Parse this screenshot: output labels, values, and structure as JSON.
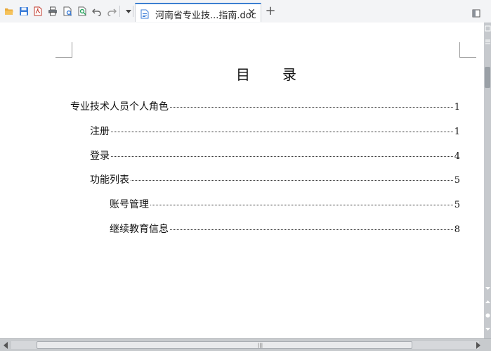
{
  "toolbar": {
    "icons": [
      "open-folder-icon",
      "save-icon",
      "export-pdf-icon",
      "print-icon",
      "print-preview-icon",
      "find-icon",
      "undo-icon",
      "redo-icon",
      "more-dropdown-icon"
    ],
    "tab": {
      "label": "河南省专业技...指南.doc",
      "close_glyph": "✕"
    },
    "new_tab_glyph": "+"
  },
  "document": {
    "title": "目　　录",
    "toc": [
      {
        "label": "专业技术人员个人角色",
        "page": "1",
        "level": 1
      },
      {
        "label": "注册",
        "page": "1",
        "level": 2
      },
      {
        "label": "登录",
        "page": "4",
        "level": 2
      },
      {
        "label": "功能列表",
        "page": "5",
        "level": 2
      },
      {
        "label": "账号管理",
        "page": "5",
        "level": 3
      },
      {
        "label": "继续教育信息",
        "page": "8",
        "level": 3
      }
    ]
  },
  "scrollbar": {
    "grip": "|||"
  },
  "colors": {
    "accent": "#3c7fd1",
    "toolbar_bg": "#f3f4f6",
    "scroll_bg": "#c6c9cd"
  }
}
